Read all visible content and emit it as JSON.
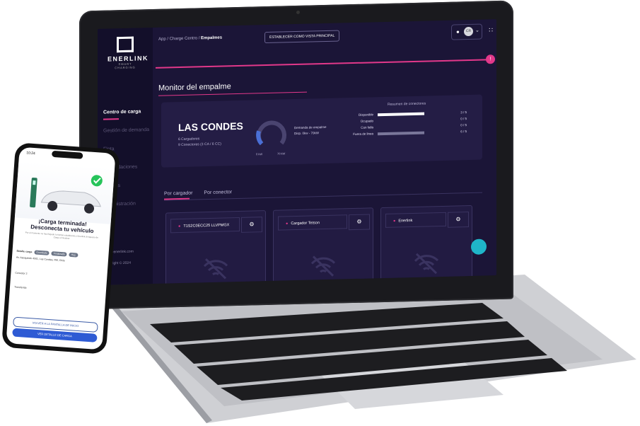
{
  "laptop": {
    "logo": {
      "name": "ENERLINK",
      "tagline": "SMART CHARGING"
    },
    "nav": [
      "Centro de carga",
      "Gestión de demanda",
      "Flota",
      "Recaudaciones",
      "Análisis",
      "Administración"
    ],
    "footer": {
      "email": "hola@enerlink.com",
      "copyright": "Copyright © 2024"
    },
    "breadcrumb": {
      "path": "App / Charge Centro /",
      "current": "Empalmes"
    },
    "pin_button": "ESTABLECER COMO VISTA PRINCIPAL",
    "user_initials": "CR",
    "page_title": "Monitor del empalme",
    "site": {
      "name": "LAS CONDES",
      "chargers": "6 Cargadores",
      "connectors": "9 Conectores (3 CA / 6 CC)"
    },
    "gauge": {
      "min_label": "0 kW",
      "max_label": "70 kW",
      "fill_fraction": 0.35
    },
    "gauge_legend": [
      "Demanda de empalme",
      "Disp. 0kw - 70kW"
    ],
    "summary": {
      "title": "Resumen de conectores",
      "rows": [
        {
          "label": "Disponible",
          "value": "3 / 5",
          "fraction": 0.6,
          "color": "#ffffff"
        },
        {
          "label": "Ocupado",
          "value": "0 / 5",
          "fraction": 0.0,
          "color": "#ffffff"
        },
        {
          "label": "Con falla",
          "value": "0 / 5",
          "fraction": 0.0,
          "color": "#ffffff"
        },
        {
          "label": "Fuera de linea",
          "value": "6 / 5",
          "fraction": 0.6,
          "color": "#7a779a"
        }
      ]
    },
    "tabs": [
      "Por cargador",
      "Por conector"
    ],
    "chargers": [
      {
        "name": "T1S2C0ECC25 LLVPMGX"
      },
      {
        "name": "Cargador Tetson"
      },
      {
        "name": "Enerlink"
      }
    ]
  },
  "phone": {
    "time": "10:24",
    "title_line1": "¡Carga terminada!",
    "title_line2": "Desconecta tu vehículo",
    "subtitle": "Por el momento no has llegado tu tiempo establecido y Enerlink di espacio de Carga a Finalizar",
    "detail_label": "Detalle carga",
    "chips": [
      "Guardado",
      "Finalizado",
      "Hoy"
    ],
    "address": "Av. Apoquindo 4501, Las Condes, RM, Chile",
    "connector": "Conector 2",
    "energy": "Transferido",
    "outline_button": "VOLVER A LA PANTALLA DE INICIO",
    "primary_button": "VER DETALLE DE CARGA"
  },
  "colors": {
    "accent": "#e2388a",
    "bg": "#1b1537",
    "teal": "#1fb6c9"
  }
}
